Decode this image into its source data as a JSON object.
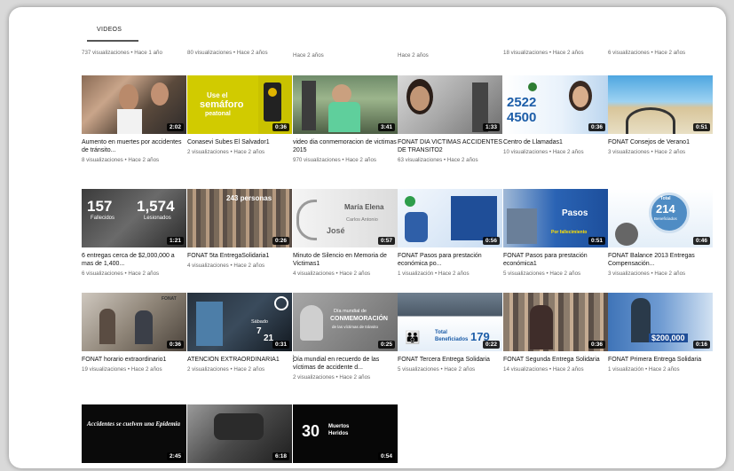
{
  "tab": {
    "label": "VIDEOS"
  },
  "top_row": [
    {
      "meta": "737 visualizaciones • Hace 1 año"
    },
    {
      "meta": "80 visualizaciones • Hace 2 años"
    },
    {
      "meta": "Hace 2 años"
    },
    {
      "meta": "Hace 2 años"
    },
    {
      "meta": "18 visualizaciones • Hace 2 años"
    },
    {
      "meta": "6 visualizaciones • Hace 2 años"
    }
  ],
  "rows": [
    [
      {
        "title": "Aumento en muertes por accidentes de tránsito...",
        "meta": "8 visualizaciones • Hace 2 años",
        "duration": "2:02"
      },
      {
        "title": "Conasevi Subes El Salvador1",
        "meta": "2 visualizaciones • Hace 2 años",
        "duration": "0:36",
        "overlay": [
          "Use el",
          "semáforo",
          "peatonal"
        ]
      },
      {
        "title": "video dia conmemoracion de victimas 2015",
        "meta": "970 visualizaciones • Hace 2 años",
        "duration": "3:41"
      },
      {
        "title": "FONAT DIA VICTIMAS ACCIDENTES DE TRANSITO2",
        "meta": "63 visualizaciones • Hace 2 años",
        "duration": "1:33"
      },
      {
        "title": "Centro de Llamadas1",
        "meta": "10 visualizaciones • Hace 2 años",
        "duration": "0:36",
        "overlay": [
          "2522",
          "4500"
        ]
      },
      {
        "title": "FONAT Consejos de Verano1",
        "meta": "3 visualizaciones • Hace 2 años",
        "duration": "0:51"
      }
    ],
    [
      {
        "title": "6 entregas cerca de $2,000,000 a mas de 1,400...",
        "meta": "6 visualizaciones • Hace 2 años",
        "duration": "1:21",
        "overlay": [
          "157",
          "1,574",
          "Fallecidos",
          "Lesionados"
        ]
      },
      {
        "title": "FONAT 5ta EntregaSolidaria1",
        "meta": "4 visualizaciones • Hace 2 años",
        "duration": "0:26",
        "overlay": [
          "243 personas"
        ]
      },
      {
        "title": "Minuto de Silencio en Memoria de Victimas1",
        "meta": "4 visualizaciones • Hace 2 años",
        "duration": "0:57",
        "overlay": [
          "María Elena",
          "Carlos Antonio",
          "José"
        ]
      },
      {
        "title": "FONAT Pasos para prestación económica po...",
        "meta": "1 visualización • Hace 2 años",
        "duration": "0:56"
      },
      {
        "title": "FONAT Pasos para prestación económica1",
        "meta": "5 visualizaciones • Hace 2 años",
        "duration": "0:51",
        "overlay": [
          "Pasos",
          "Por fallecimiento"
        ]
      },
      {
        "title": "FONAT Balance 2013 Entregas Compensación...",
        "meta": "3 visualizaciones • Hace 2 años",
        "duration": "0:46",
        "overlay": [
          "Total",
          "214",
          "Beneficiados"
        ]
      }
    ],
    [
      {
        "title": "FONAT horario extraordinario1",
        "meta": "19 visualizaciones • Hace 2 años",
        "duration": "0:36",
        "overlay": [
          "FONAT"
        ]
      },
      {
        "title": "ATENCIÓN EXTRAORDINARIA1",
        "meta": "2 visualizaciones • Hace 2 años",
        "duration": "0:31",
        "overlay": [
          "Sábado",
          "7",
          "21"
        ]
      },
      {
        "title": "Día mundial en recuerdo de las víctimas de accidente d...",
        "meta": "2 visualizaciones • Hace 2 años",
        "duration": "0:25",
        "overlay": [
          "Día mundial de",
          "CONMEMORACIÓN",
          "de las víctimas de tránsito"
        ]
      },
      {
        "title": "FONAT Tercera Entrega Solidaria",
        "meta": "5 visualizaciones • Hace 2 años",
        "duration": "0:22",
        "overlay": [
          "Total",
          "Beneficiados",
          "179"
        ]
      },
      {
        "title": "FONAT Segunda Entrega Solidaria",
        "meta": "14 visualizaciones • Hace 2 años",
        "duration": "0:36"
      },
      {
        "title": "FONAT Primera Entrega Solidaria",
        "meta": "1 visualización • Hace 2 años",
        "duration": "0:16",
        "overlay": [
          "$200,000"
        ]
      }
    ],
    [
      {
        "duration": "2:45",
        "overlay": [
          "Accidentes se cuelven una Epidemia"
        ]
      },
      {
        "duration": "6:18"
      },
      {
        "duration": "0:54",
        "overlay": [
          "30",
          "Muertos",
          "Heridos"
        ]
      }
    ]
  ],
  "colors": {
    "dur_bg": "#000000",
    "meta_text": "#666666",
    "title_text": "#111111"
  }
}
